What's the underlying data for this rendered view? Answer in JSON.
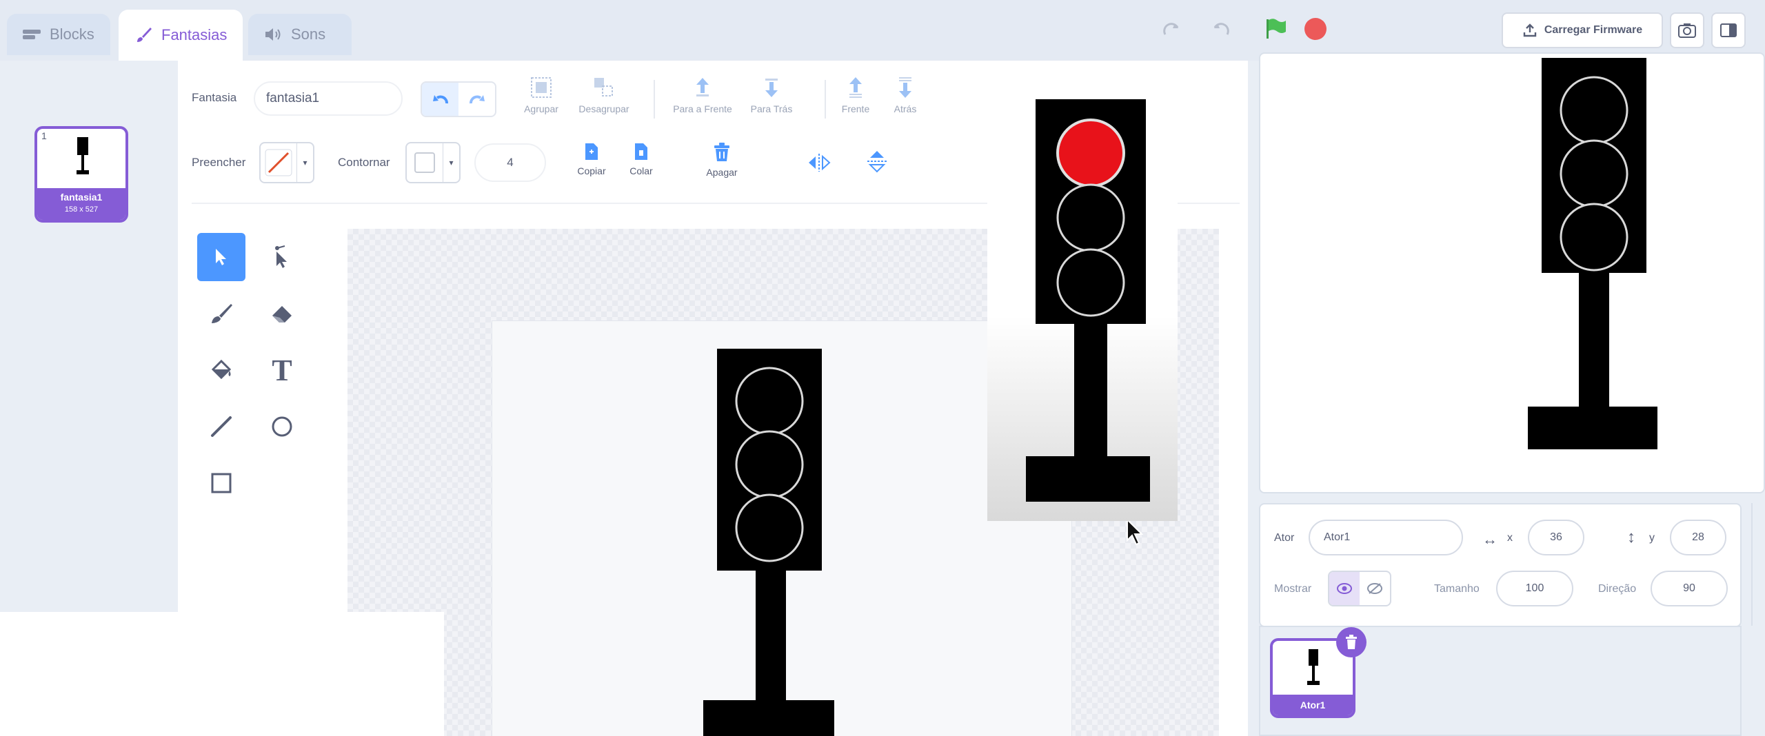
{
  "tabs": [
    {
      "label": "Blocks",
      "icon": "blocks-icon"
    },
    {
      "label": "Fantasias",
      "icon": "brush-icon"
    },
    {
      "label": "Sons",
      "icon": "speaker-icon"
    }
  ],
  "header": {
    "upload_firmware_label": "Carregar Firmware"
  },
  "costume": {
    "index": "1",
    "name": "fantasia1",
    "size": "158 x 527"
  },
  "editor": {
    "costume_label": "Fantasia",
    "costume_name_value": "fantasia1",
    "fill_label": "Preencher",
    "outline_label": "Contornar",
    "outline_width": "4",
    "group_label": "Agrupar",
    "ungroup_label": "Desagrupar",
    "forward_label": "Para a Frente",
    "backward_label": "Para Trás",
    "front_label": "Frente",
    "back_label": "Atrás",
    "copy_label": "Copiar",
    "paste_label": "Colar",
    "delete_label": "Apagar"
  },
  "sprite_info": {
    "sprite_label": "Ator",
    "sprite_name": "Ator1",
    "x_label": "x",
    "x_value": "36",
    "y_label": "y",
    "y_value": "28",
    "show_label": "Mostrar",
    "size_label": "Tamanho",
    "size_value": "100",
    "direction_label": "Direção",
    "direction_value": "90"
  },
  "sprite_list": {
    "sprite_name": "Ator1"
  },
  "colors": {
    "accent": "#855cd6",
    "selected_tool": "#4c97ff",
    "go_flag": "#4cbf56",
    "stop": "#ec5959",
    "red_light": "#e8121a"
  }
}
